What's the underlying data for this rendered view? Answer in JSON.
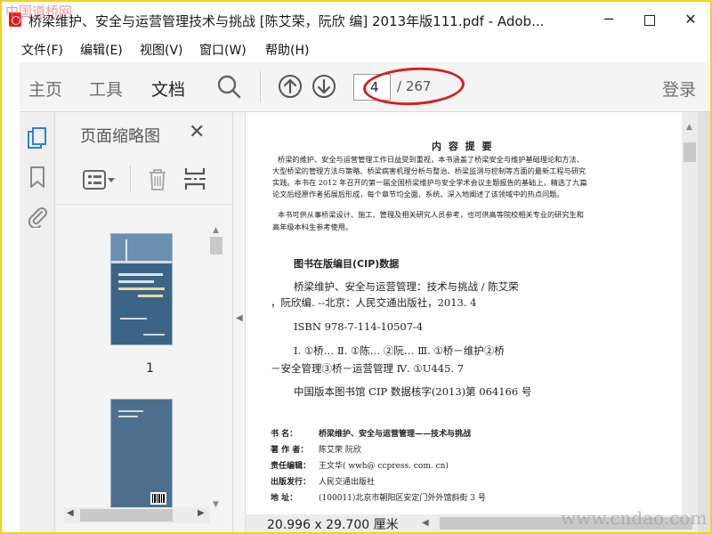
{
  "window": {
    "title": "桥梁维护、安全与运营管理技术与挑战 [陈艾荣，阮欣 编] 2013年版111.pdf - Adob...",
    "minimize": "─",
    "close": "✕",
    "corner_watermark": "中国道桥网"
  },
  "menu": [
    "文件(F)",
    "编辑(E)",
    "视图(V)",
    "窗口(W)",
    "帮助(H)"
  ],
  "toolbar": {
    "tabs": [
      "主页",
      "工具",
      "文档"
    ],
    "page_current": "4",
    "page_total": "/ 267",
    "login": "登录",
    "icons": [
      "search-icon",
      "prev-page-icon",
      "next-page-icon"
    ]
  },
  "sidebar": {
    "panel_title": "页面缩略图",
    "close": "✕",
    "thumb_label_1": "1",
    "rail_icons": [
      "page-thumbnails-icon",
      "bookmark-icon",
      "attachment-icon"
    ]
  },
  "document": {
    "summary_title": "内 容 提 要",
    "summary_lines": [
      "桥梁的维护、安全与运营管理工作日益受到重视，本书涵盖了桥梁安全与维护基础理论和方法、",
      "大型桥梁的管理方法与策略、桥梁病害机理分析与整治、桥梁监测与控制等方面的最新工程与研究",
      "实践。本书在 2012 年召开的第一届全国桥梁维护与安全学术会议主题报告的基础上，精选了九篇",
      "论文后经原作者拓展后形成，每个章节均全面、系统、深入地阐述了该领域中的热点问题。",
      "本书可供从事桥梁设计、施工、管理及相关研究人员参考，也可供高等院校相关专业的研究生和",
      "高年级本科生参考使用。"
    ],
    "cip_heading": "图书在版编目(CIP)数据",
    "cip_lines": [
      "桥梁维护、安全与运营管理：技术与挑战 / 陈艾荣",
      "，阮欣编. --北京：人民交通出版社，2013. 4",
      "ISBN 978-7-114-10507-4",
      "Ⅰ. ①桥…  Ⅱ. ①陈…  ②阮…  Ⅲ. ①桥－维护②桥",
      "－安全管理③桥－运营管理  Ⅳ. ①U445. 7",
      "中国版本图书馆 CIP 数据核字(2013)第 064166 号"
    ],
    "meta": [
      {
        "label": "书      名：",
        "value": "桥梁维护、安全与运营管理——技术与挑战"
      },
      {
        "label": "著 作 者：",
        "value": "陈艾荣   阮欣"
      },
      {
        "label": "责任编辑：",
        "value": "王文华( wwh@ ccpress. com. cn)"
      },
      {
        "label": "出版发行：",
        "value": "人民交通出版社"
      },
      {
        "label": "地      址：",
        "value": "(100011)北京市朝阳区安定门外外馆斜街 3 号"
      }
    ],
    "page_size": "20.996 x 29.700 厘米",
    "bottom_watermark": "www.cndao.com"
  }
}
